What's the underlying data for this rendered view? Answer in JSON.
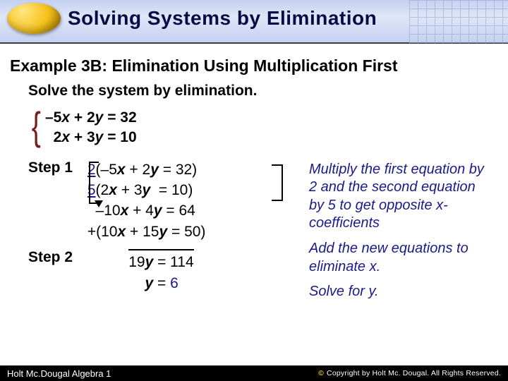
{
  "header": {
    "title": "Solving Systems by Elimination"
  },
  "example_title": "Example 3B: Elimination Using Multiplication First",
  "instruction": "Solve the system by elimination.",
  "system": {
    "eq1_lhs_a": "–5",
    "eq1_lhs_b": " + 2",
    "eq1_rhs": " = 32",
    "eq2_lhs_a": "2",
    "eq2_lhs_b": " + 3",
    "eq2_rhs": " = 10"
  },
  "steps": {
    "step1_label": "Step 1",
    "step2_label": "Step 2",
    "m1_prefix": "2",
    "m1_body_a": "(–5",
    "m1_body_b": " + 2",
    "m1_body_c": " = 32)",
    "m2_prefix": "5",
    "m2_body_a": "(2",
    "m2_body_b": " + 3",
    "m2_body_c": "  = 10)",
    "r1_a": "–10",
    "r1_b": " + 4",
    "r1_c": " = 64",
    "r2_pre": "+(10",
    "r2_b": " + 15",
    "r2_c": " = 50)",
    "sum_a": "19",
    "sum_b": " = 114",
    "solve_a": "y",
    "solve_b": " = ",
    "solve_c": "6"
  },
  "explain": {
    "p1": "Multiply the first equation by 2 and the second equation by 5 to get opposite x-coefficients",
    "p2": "Add the new equations to eliminate x.",
    "p3": "Solve for y."
  },
  "footer": {
    "left": "Holt Mc.Dougal Algebra 1",
    "right": "by Holt Mc. Dougal. All Rights Reserved.",
    "copyright_word": "Copyright"
  }
}
